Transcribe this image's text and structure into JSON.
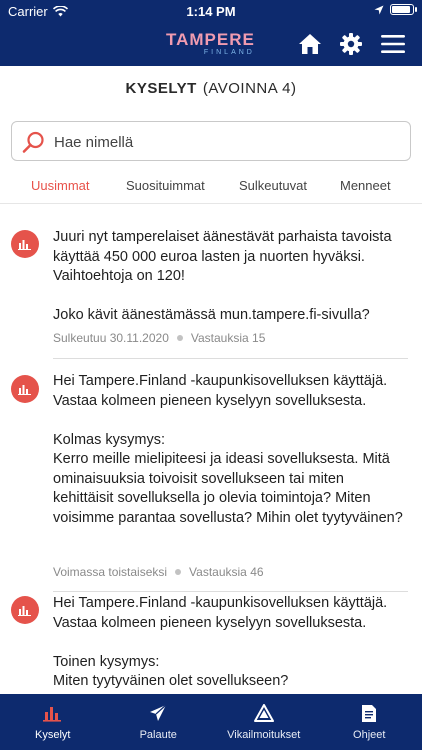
{
  "status_bar": {
    "carrier": "Carrier",
    "time": "1:14 PM"
  },
  "header": {
    "logo_main": "TAMPERE",
    "logo_sub": "FINLAND",
    "icons": [
      "home-icon",
      "gear-icon",
      "menu-icon"
    ]
  },
  "page": {
    "title_bold": "KYSELYT",
    "title_count": "(AVOINNA 4)"
  },
  "search": {
    "placeholder": "Hae nimellä",
    "value": ""
  },
  "tabs": [
    {
      "label": "Uusimmat",
      "active": true
    },
    {
      "label": "Suosituimmat",
      "active": false
    },
    {
      "label": "Sulkeutuvat",
      "active": false
    },
    {
      "label": "Menneet",
      "active": false
    }
  ],
  "surveys": [
    {
      "para1": "Juuri nyt tamperelaiset äänestävät parhaista tavoista käyttää 450 000 euroa lasten ja nuorten hyväksi. Vaihtoehtoja on 120!",
      "para2": "Joko kävit äänestämässä mun.tampere.fi-sivulla?",
      "status": "Sulkeutuu 30.11.2020",
      "answers": "Vastauksia 15"
    },
    {
      "para1": "Hei Tampere.Finland -kaupunkisovelluksen käyttäjä. Vastaa kolmeen pieneen kyselyyn sovelluksesta.",
      "para2_head": "Kolmas kysymys:",
      "para2": "Kerro meille mielipiteesi ja ideasi sovelluksesta. Mitä ominaisuuksia toivoisit sovellukseen tai miten kehittäisit sovelluksella jo olevia toimintoja? Miten voisimme parantaa sovellusta? Mihin olet tyytyväinen?",
      "status": "Voimassa toistaiseksi",
      "answers": "Vastauksia 46"
    },
    {
      "para1": "Hei Tampere.Finland -kaupunkisovelluksen käyttäjä. Vastaa kolmeen pieneen kyselyyn sovelluksesta.",
      "para2_head": "Toinen kysymys:",
      "para2": "Miten tyytyväinen olet sovellukseen?"
    }
  ],
  "bottom_nav": [
    {
      "label": "Kyselyt",
      "icon": "bar-chart-icon",
      "active": true
    },
    {
      "label": "Palaute",
      "icon": "paper-plane-icon",
      "active": false
    },
    {
      "label": "Vikailmoitukset",
      "icon": "warning-icon",
      "active": false
    },
    {
      "label": "Ohjeet",
      "icon": "document-icon",
      "active": false
    }
  ],
  "colors": {
    "brand_navy": "#0d2a6e",
    "accent_red": "#e5534b",
    "logo_pink": "#f09bb0"
  }
}
